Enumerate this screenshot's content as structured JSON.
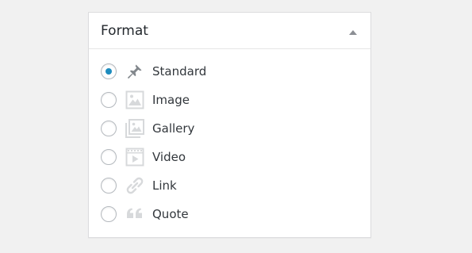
{
  "panel": {
    "title": "Format",
    "toggle_icon": "triangle-up-icon"
  },
  "format_options": [
    {
      "label": "Standard",
      "icon": "pushpin-icon",
      "selected": true
    },
    {
      "label": "Image",
      "icon": "image-icon",
      "selected": false
    },
    {
      "label": "Gallery",
      "icon": "gallery-icon",
      "selected": false
    },
    {
      "label": "Video",
      "icon": "video-icon",
      "selected": false
    },
    {
      "label": "Link",
      "icon": "link-icon",
      "selected": false
    },
    {
      "label": "Quote",
      "icon": "quote-icon",
      "selected": false
    }
  ],
  "colors": {
    "selected_dot": "#1e8cbe",
    "icon_active": "#82878c",
    "icon_inactive": "#d7d9db"
  }
}
